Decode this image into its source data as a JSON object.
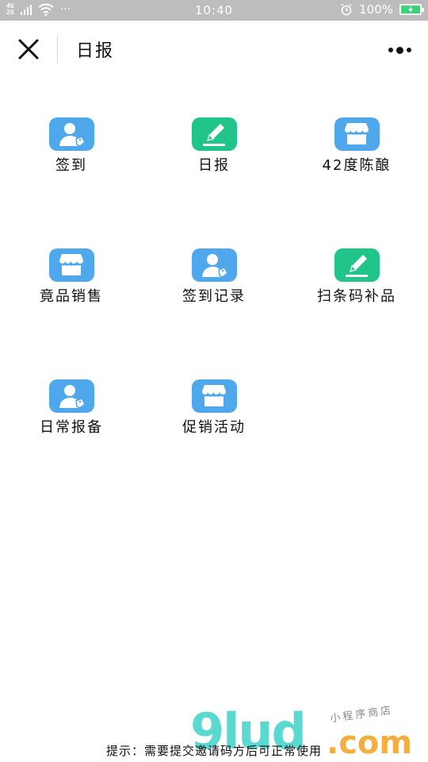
{
  "status_bar": {
    "network_top": "4G",
    "network_bottom": "2G",
    "more": "···",
    "time": "10:40",
    "battery": "100%"
  },
  "title_bar": {
    "title": "日报",
    "close_icon": "close-icon",
    "more_icon": "more-icon"
  },
  "grid": {
    "items": [
      {
        "label": "签到",
        "icon": "user-tag-icon",
        "color": "#4fa7ec"
      },
      {
        "label": "日报",
        "icon": "pencil-icon",
        "color": "#21c58a"
      },
      {
        "label": "42度陈酿",
        "icon": "store-icon",
        "color": "#4fa7ec"
      },
      {
        "label": "竟品销售",
        "icon": "store-icon",
        "color": "#4fa7ec"
      },
      {
        "label": "签到记录",
        "icon": "user-tag-icon",
        "color": "#4fa7ec"
      },
      {
        "label": "扫条码补品",
        "icon": "pencil-icon",
        "color": "#21c58a"
      },
      {
        "label": "日常报备",
        "icon": "user-tag-icon",
        "color": "#4fa7ec"
      },
      {
        "label": "促销活动",
        "icon": "store-icon",
        "color": "#4fa7ec"
      }
    ]
  },
  "footer": {
    "hint": "提示：需要提交邀请码方后可正常使用"
  },
  "watermark": {
    "brand": "9lud",
    "domain": ".com",
    "tagline": "小程序商店"
  }
}
